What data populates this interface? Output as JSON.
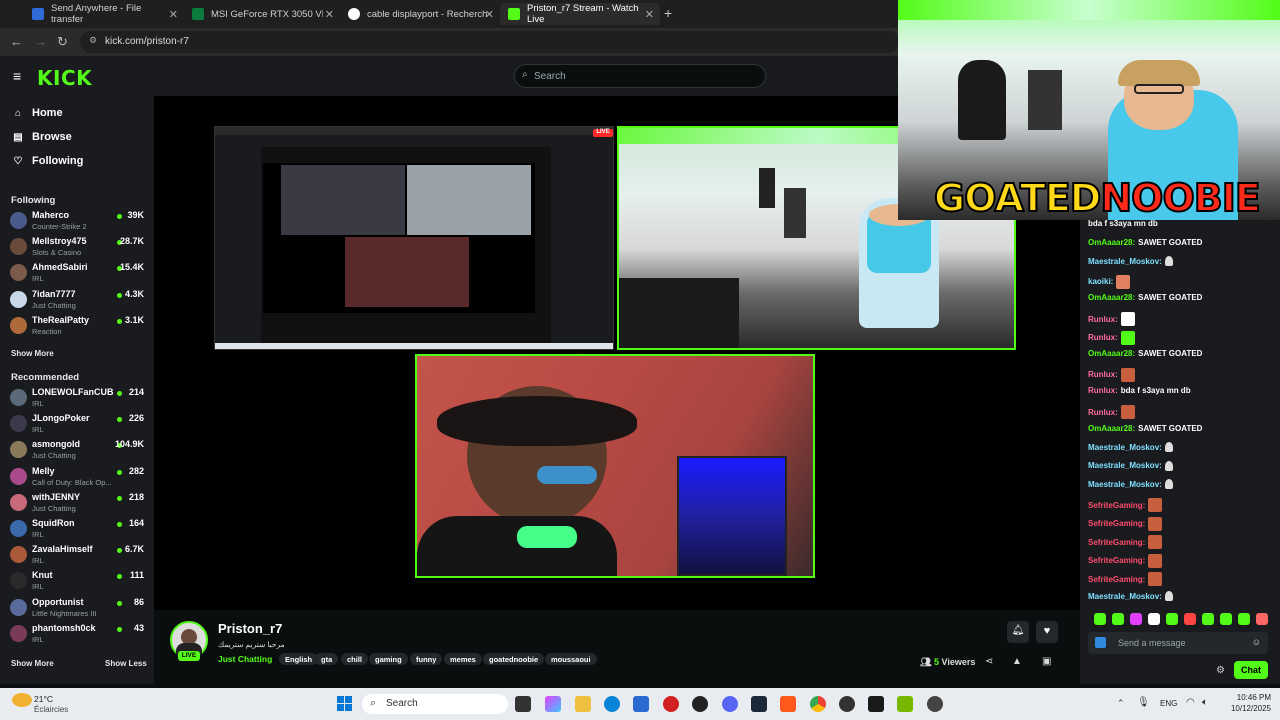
{
  "browser": {
    "tabs": [
      {
        "label": "Send Anywhere - File transfer",
        "color": "#2f6bd8"
      },
      {
        "label": "MSI GeForce RTX 3050 VENTUS",
        "color": "#0a7d3e"
      },
      {
        "label": "cable displayport - Recherche G",
        "color": "#e8e8e8"
      },
      {
        "label": "Priston_r7 Stream - Watch Live",
        "color": "#53fc18"
      }
    ],
    "new_tab": "+",
    "url": "kick.com/priston-r7"
  },
  "header": {
    "logo": "KICK",
    "search_placeholder": "Search"
  },
  "sidebar": {
    "nav": [
      {
        "label": "Home",
        "icon": "home-icon"
      },
      {
        "label": "Browse",
        "icon": "browse-icon"
      },
      {
        "label": "Following",
        "icon": "heart-icon"
      }
    ],
    "following_title": "Following",
    "following": [
      {
        "name": "Maherco",
        "category": "Counter-Strike 2",
        "viewers": "39K",
        "color": "#4a5a8a"
      },
      {
        "name": "Mellstroy475",
        "category": "Slots & Casino",
        "viewers": "28.7K",
        "color": "#6a4a3a"
      },
      {
        "name": "AhmedSabiri",
        "category": "IRL",
        "viewers": "15.4K",
        "color": "#7a5a4a"
      },
      {
        "name": "7idan7777",
        "category": "Just Chatting",
        "viewers": "4.3K",
        "color": "#c8d8e8"
      },
      {
        "name": "TheRealPatty",
        "category": "Reaction",
        "viewers": "3.1K",
        "color": "#b06a3a"
      }
    ],
    "show_more": "Show More",
    "recommended_title": "Recommended",
    "recommended": [
      {
        "name": "LONEWOLFanCUB",
        "category": "IRL",
        "viewers": "214",
        "color": "#5a6a7a"
      },
      {
        "name": "JLongoPoker",
        "category": "IRL",
        "viewers": "226",
        "color": "#3a3a4a"
      },
      {
        "name": "asmongold",
        "category": "Just Chatting",
        "viewers": "104.9K",
        "color": "#8a7a5a"
      },
      {
        "name": "Melly",
        "category": "Call of Duty: Black Op...",
        "viewers": "282",
        "color": "#aa4a8a"
      },
      {
        "name": "withJENNY",
        "category": "Just Chatting",
        "viewers": "218",
        "color": "#c86a7a"
      },
      {
        "name": "SquidRon",
        "category": "IRL",
        "viewers": "164",
        "color": "#3a6aaa"
      },
      {
        "name": "ZavalaHimself",
        "category": "IRL",
        "viewers": "6.7K",
        "color": "#aa5a3a"
      },
      {
        "name": "Knut",
        "category": "IRL",
        "viewers": "111",
        "color": "#2a2a2a"
      },
      {
        "name": "Opportunist",
        "category": "Little Nightmares III",
        "viewers": "86",
        "color": "#5a6a9a"
      },
      {
        "name": "phantomsh0ck",
        "category": "IRL",
        "viewers": "43",
        "color": "#7a3a5a"
      }
    ],
    "show_more_bottom": "Show More",
    "show_less": "Show Less"
  },
  "stream": {
    "live_badge": "LIVE",
    "overlay_text_a": "GOATED",
    "overlay_text_b": "NOOBIE"
  },
  "chat": {
    "messages": [
      {
        "user": "",
        "text": "bda f s3aya mn db",
        "color": "#ff6b6b",
        "emote": null
      },
      {
        "user": "OmAaaar28:",
        "text": "SAWET GOATED",
        "color": "#53fc18",
        "emote": null
      },
      {
        "user": "Maestrale_Moskov:",
        "text": "",
        "color": "#7fe0ff",
        "emote": "#dddddd"
      },
      {
        "user": "kaoiki:",
        "text": "",
        "color": "#7fe0ff",
        "emote": "#e08060"
      },
      {
        "user": "OmAaaar28:",
        "text": "SAWET GOATED",
        "color": "#53fc18",
        "emote": null
      },
      {
        "user": "Runlux:",
        "text": "",
        "color": "#ff6b9b",
        "emote": "#ffffff"
      },
      {
        "user": "Runlux:",
        "text": "",
        "color": "#ff6b9b",
        "emote": "#53fc18"
      },
      {
        "user": "OmAaaar28:",
        "text": "SAWET GOATED",
        "color": "#53fc18",
        "emote": null
      },
      {
        "user": "Runlux:",
        "text": "",
        "color": "#ff6b9b",
        "emote": "#c86040"
      },
      {
        "user": "Runlux:",
        "text": "bda f s3aya mn db",
        "color": "#ff6b9b",
        "emote": null
      },
      {
        "user": "Runlux:",
        "text": "",
        "color": "#ff6b9b",
        "emote": "#c86040"
      },
      {
        "user": "OmAaaar28:",
        "text": "SAWET GOATED",
        "color": "#53fc18",
        "emote": null
      },
      {
        "user": "Maestrale_Moskov:",
        "text": "",
        "color": "#7fe0ff",
        "emote": "#dddddd"
      },
      {
        "user": "Maestrale_Moskov:",
        "text": "",
        "color": "#7fe0ff",
        "emote": "#dddddd"
      },
      {
        "user": "Maestrale_Moskov:",
        "text": "",
        "color": "#7fe0ff",
        "emote": "#dddddd"
      },
      {
        "user": "SefriteGaming:",
        "text": "",
        "color": "#ff4d6d",
        "emote": "#c86040"
      },
      {
        "user": "SefriteGaming:",
        "text": "",
        "color": "#ff4d6d",
        "emote": "#c86040"
      },
      {
        "user": "SefriteGaming:",
        "text": "",
        "color": "#ff4d6d",
        "emote": "#c86040"
      },
      {
        "user": "SefriteGaming:",
        "text": "",
        "color": "#ff4d6d",
        "emote": "#c86040"
      },
      {
        "user": "SefriteGaming:",
        "text": "",
        "color": "#ff4d6d",
        "emote": "#c86040"
      },
      {
        "user": "Maestrale_Moskov:",
        "text": "",
        "color": "#7fe0ff",
        "emote": "#dddddd"
      }
    ],
    "emote_bar": [
      "#53fc18",
      "#53fc18",
      "#e040fb",
      "#ffffff",
      "#53fc18",
      "#ff4444",
      "#53fc18",
      "#53fc18",
      "#53fc18",
      "#ff6666"
    ],
    "input_placeholder": "Send a message",
    "chat_button": "Chat"
  },
  "channel": {
    "name": "Priston_r7",
    "subtitle": "مرحبا ستريم ستريمك",
    "live": "LIVE",
    "category": "Just Chatting",
    "tags": [
      "English",
      "gta",
      "chill",
      "gaming",
      "funny",
      "memes",
      "goatednoobie",
      "moussaoui"
    ],
    "viewers": "5",
    "viewers_label": "Viewers"
  },
  "taskbar": {
    "weather_temp": "21°C",
    "weather_desc": "Éclaircies",
    "search": "Search",
    "lang": "ENG",
    "time": "10:46 PM",
    "date": "10/12/2025"
  }
}
